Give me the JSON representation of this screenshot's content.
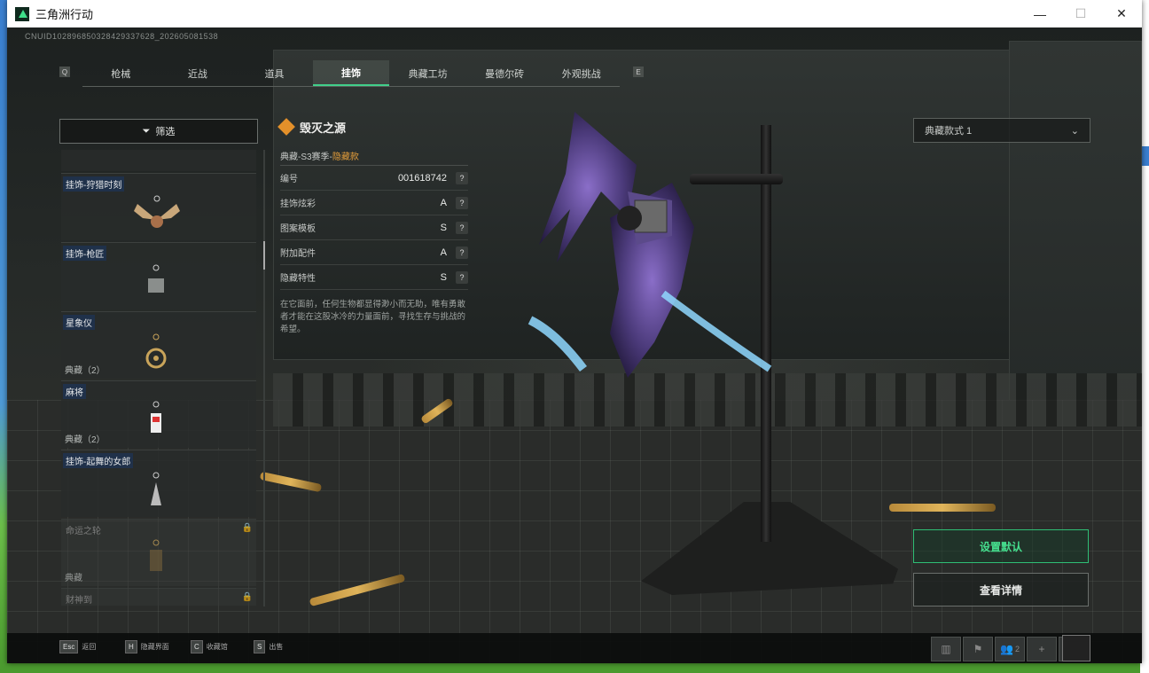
{
  "window": {
    "title": "三角洲行动",
    "minimize": "—",
    "maximize": "☐",
    "close": "✕"
  },
  "uid": "CNUID102896850328429337628_202605081538",
  "tabs": {
    "left_key": "Q",
    "right_key": "E",
    "items": [
      {
        "label": "枪械"
      },
      {
        "label": "近战"
      },
      {
        "label": "道具"
      },
      {
        "label": "挂饰",
        "active": true
      },
      {
        "label": "典藏工坊"
      },
      {
        "label": "曼德尔砖"
      },
      {
        "label": "外观挑战"
      }
    ]
  },
  "filter": {
    "label": "筛选"
  },
  "list": {
    "items": [
      {
        "name": "挂饰-狩猎时刻",
        "sub": "",
        "locked": false,
        "icon": "antler-charm-icon"
      },
      {
        "name": "挂饰-枪匠",
        "sub": "",
        "locked": false,
        "icon": "toolbox-charm-icon"
      },
      {
        "name": "星象仪",
        "sub": "典藏（2）",
        "locked": false,
        "icon": "astrolabe-charm-icon"
      },
      {
        "name": "麻将",
        "sub": "典藏（2）",
        "locked": false,
        "icon": "mahjong-charm-icon"
      },
      {
        "name": "挂饰-起舞的女郎",
        "sub": "",
        "locked": false,
        "icon": "dancer-charm-icon"
      },
      {
        "name": "命运之轮",
        "sub": "典藏",
        "locked": true,
        "icon": "tarot-charm-icon"
      },
      {
        "name": "财神到",
        "sub": "",
        "locked": true,
        "icon": "fortune-charm-icon"
      }
    ]
  },
  "detail": {
    "title": "毁灭之源",
    "season": "典藏-S3赛季-",
    "season_tag": "隐藏款",
    "rows": [
      {
        "key": "编号",
        "value": "001618742"
      },
      {
        "key": "挂饰炫彩",
        "value": "A"
      },
      {
        "key": "图案模板",
        "value": "S"
      },
      {
        "key": "附加配件",
        "value": "A"
      },
      {
        "key": "隐藏特性",
        "value": "S"
      }
    ],
    "q": "?",
    "description": "在它面前，任何生物都显得渺小而无助，唯有勇敢者才能在这股冰冷的力量面前，寻找生存与挑战的希望。"
  },
  "variant": {
    "label": "典藏款式 1"
  },
  "buttons": {
    "set_default": "设置默认",
    "view_detail": "查看详情"
  },
  "hotkeys": [
    {
      "key": "Esc",
      "label": "返回"
    },
    {
      "key": "H",
      "label": "隐藏界面"
    },
    {
      "key": "C",
      "label": "收藏馆"
    },
    {
      "key": "S",
      "label": "出售"
    }
  ],
  "bottom_icons": {
    "squad_count": "2"
  },
  "colors": {
    "accent": "#41d08a",
    "hidden_tag": "#e39d3a",
    "diamond": "#e3902a"
  }
}
